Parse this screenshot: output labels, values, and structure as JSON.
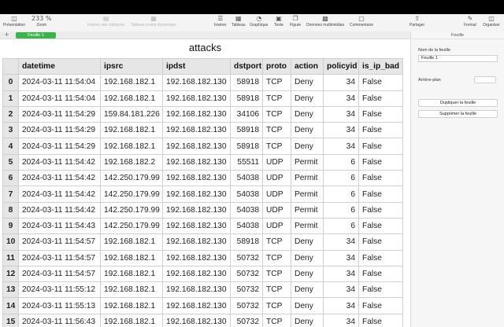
{
  "toolbar": {
    "presentation": "Présentation",
    "zoom": "233 %",
    "zoom_label": "Zoom",
    "add_category": "Insérer une catégorie",
    "pivot_table": "Tableau croisé dynamique",
    "insert": "Insérer",
    "table": "Tableau",
    "chart": "Graphique",
    "text": "Texte",
    "shape": "Figure",
    "media": "Données multimédias",
    "comment": "Commentaire",
    "share": "Partager",
    "format": "Format",
    "organize": "Organiser"
  },
  "sheet_tabs": {
    "active": "Feuille 1"
  },
  "inspector": {
    "header": "Feuille",
    "name_label": "Nom de la feuille",
    "name_value": "Feuille 1",
    "background_label": "Arrière-plan",
    "duplicate_button": "Dupliquer la feuille",
    "delete_button": "Supprimer la feuille"
  },
  "table": {
    "title": "attacks",
    "columns": [
      "",
      "datetime",
      "ipsrc",
      "ipdst",
      "dstport",
      "proto",
      "action",
      "policyid",
      "is_ip_bad"
    ],
    "rows": [
      [
        "0",
        "2024-03-11 11:54:04",
        "192.168.182.1",
        "192.168.182.130",
        "58918",
        "TCP",
        "Deny",
        "34",
        "False"
      ],
      [
        "1",
        "2024-03-11 11:54:04",
        "192.168.182.1",
        "192.168.182.130",
        "58918",
        "TCP",
        "Deny",
        "34",
        "False"
      ],
      [
        "2",
        "2024-03-11 11:54:29",
        "159.84.181.226",
        "192.168.182.130",
        "34106",
        "TCP",
        "Deny",
        "34",
        "False"
      ],
      [
        "3",
        "2024-03-11 11:54:29",
        "192.168.182.1",
        "192.168.182.130",
        "58918",
        "TCP",
        "Deny",
        "34",
        "False"
      ],
      [
        "4",
        "2024-03-11 11:54:29",
        "192.168.182.1",
        "192.168.182.130",
        "58918",
        "TCP",
        "Deny",
        "34",
        "False"
      ],
      [
        "5",
        "2024-03-11 11:54:42",
        "192.168.182.2",
        "192.168.182.130",
        "55511",
        "UDP",
        "Permit",
        "6",
        "False"
      ],
      [
        "6",
        "2024-03-11 11:54:42",
        "142.250.179.99",
        "192.168.182.130",
        "54038",
        "UDP",
        "Permit",
        "6",
        "False"
      ],
      [
        "7",
        "2024-03-11 11:54:42",
        "142.250.179.99",
        "192.168.182.130",
        "54038",
        "UDP",
        "Permit",
        "6",
        "False"
      ],
      [
        "8",
        "2024-03-11 11:54:42",
        "142.250.179.99",
        "192.168.182.130",
        "54038",
        "UDP",
        "Permit",
        "6",
        "False"
      ],
      [
        "9",
        "2024-03-11 11:54:43",
        "142.250.179.99",
        "192.168.182.130",
        "54038",
        "UDP",
        "Permit",
        "6",
        "False"
      ],
      [
        "10",
        "2024-03-11 11:54:57",
        "192.168.182.1",
        "192.168.182.130",
        "58918",
        "TCP",
        "Deny",
        "34",
        "False"
      ],
      [
        "11",
        "2024-03-11 11:54:57",
        "192.168.182.1",
        "192.168.182.130",
        "50732",
        "TCP",
        "Deny",
        "34",
        "False"
      ],
      [
        "12",
        "2024-03-11 11:54:57",
        "192.168.182.1",
        "192.168.182.130",
        "50732",
        "TCP",
        "Deny",
        "34",
        "False"
      ],
      [
        "13",
        "2024-03-11 11:55:12",
        "192.168.182.1",
        "192.168.182.130",
        "50732",
        "TCP",
        "Deny",
        "34",
        "False"
      ],
      [
        "14",
        "2024-03-11 11:55:13",
        "192.168.182.1",
        "192.168.182.130",
        "50732",
        "TCP",
        "Deny",
        "34",
        "False"
      ],
      [
        "15",
        "2024-03-11 11:56:43",
        "192.168.182.1",
        "192.168.182.130",
        "50732",
        "TCP",
        "Deny",
        "34",
        "False"
      ]
    ]
  },
  "icons": {
    "sidebar": "sidebar-icon",
    "insert": "list-icon",
    "table": "table-icon",
    "chart": "chart-icon",
    "text": "text-icon",
    "shape": "shape-icon",
    "media": "media-icon",
    "comment": "comment-icon",
    "share": "share-icon",
    "format": "brush-icon",
    "organize": "organize-icon"
  },
  "colors": {
    "active_tab": "#3bb54a",
    "header_fill": "#e6e6e6"
  }
}
